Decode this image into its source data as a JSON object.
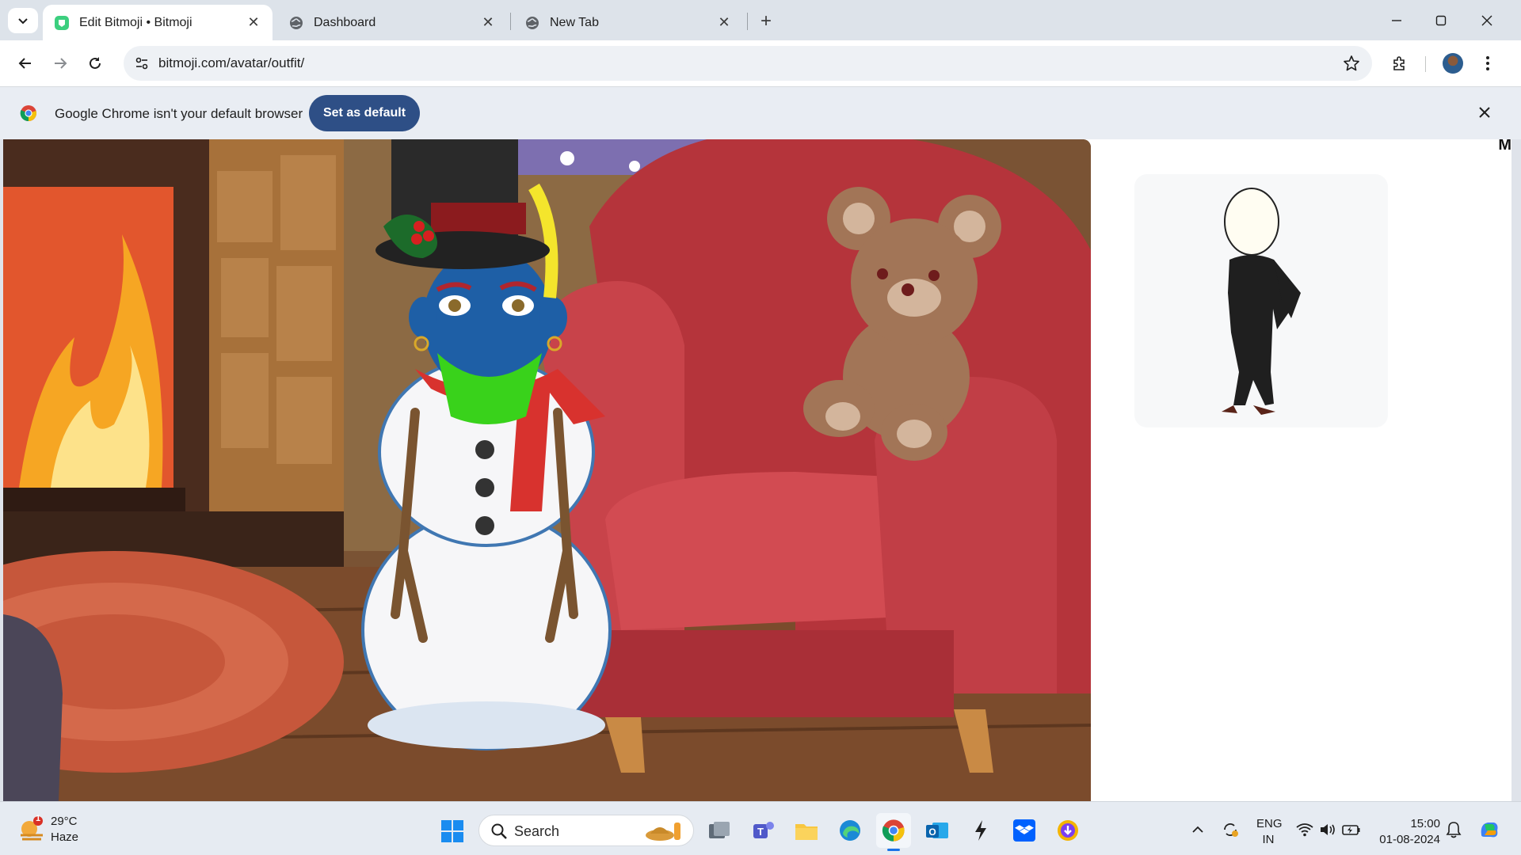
{
  "browser": {
    "tabs": [
      {
        "title": "Edit Bitmoji • Bitmoji",
        "active": true,
        "favicon": "bitmoji-icon"
      },
      {
        "title": "Dashboard",
        "active": false,
        "favicon": "globe-icon"
      },
      {
        "title": "New Tab",
        "active": false,
        "favicon": "globe-icon"
      }
    ],
    "address": {
      "host": "bitmoji.com",
      "path": "/avatar/outfit/"
    },
    "infobar": {
      "message": "Google Chrome isn't your default browser",
      "button": "Set as default"
    }
  },
  "page": {
    "scene": {
      "description_icon": "snowman-avatar-scene"
    },
    "right_panel": {
      "cut_text": "M"
    }
  },
  "taskbar": {
    "weather": {
      "temp": "29°C",
      "condition": "Haze",
      "badge": "1"
    },
    "search_label": "Search",
    "lang_line1": "ENG",
    "lang_line2": "IN",
    "time": "15:00",
    "date": "01-08-2024"
  },
  "colors": {
    "accent_button": "#2e4f86",
    "tabbar": "#dde3ea",
    "page_bg": "#ffffff"
  }
}
